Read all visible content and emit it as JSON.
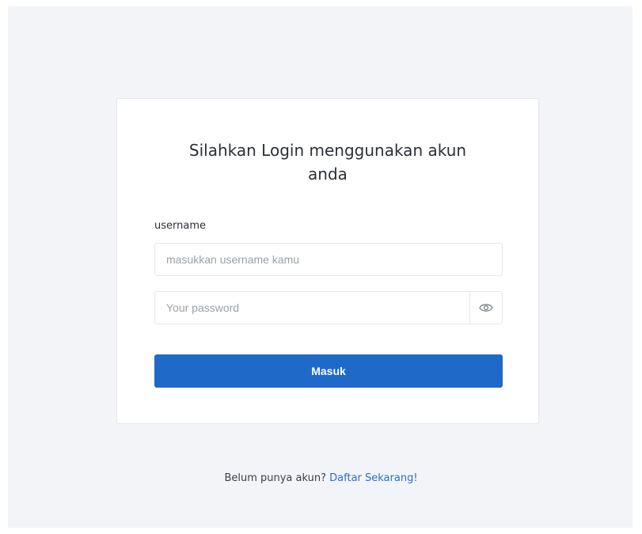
{
  "login": {
    "title_line1": "Silahkan Login menggunakan akun",
    "title_line2": "anda",
    "username_label": "username",
    "username_placeholder": "masukkan username kamu",
    "password_placeholder": "Your password",
    "submit_label": "Masuk"
  },
  "register": {
    "prompt": "Belum punya akun? ",
    "link_label": "Daftar Sekarang!"
  },
  "icons": {
    "password_toggle": "eye-icon"
  },
  "colors": {
    "primary": "#1f6ac9",
    "link": "#2a6fc9",
    "background": "#f3f4f7"
  }
}
